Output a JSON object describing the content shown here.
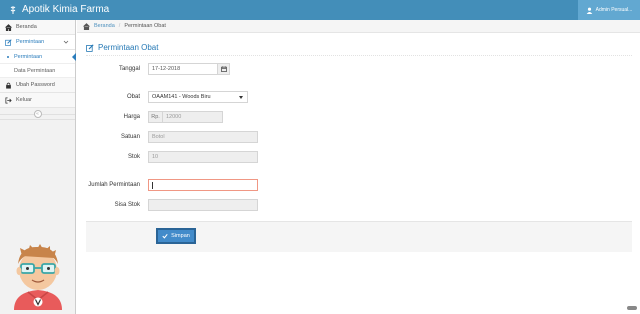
{
  "app": {
    "title": "Apotik Kimia Farma",
    "user": "Admin Persual..."
  },
  "sidebar": {
    "items": [
      {
        "label": "Beranda",
        "icon": "home-icon"
      },
      {
        "label": "Permintaan",
        "icon": "edit-icon"
      },
      {
        "label": "Ubah Password",
        "icon": "lock-icon"
      },
      {
        "label": "Keluar",
        "icon": "logout-icon"
      }
    ],
    "sub_items": [
      {
        "label": "Permintaan"
      },
      {
        "label": "Data Permintaan"
      }
    ],
    "collapse_glyph": "«"
  },
  "breadcrumb": {
    "home": "Beranda",
    "separator": "/",
    "current": "Permintaan Obat"
  },
  "page": {
    "title": "Permintaan Obat"
  },
  "form": {
    "tanggal": {
      "label": "Tanggal",
      "value": "17-12-2018"
    },
    "obat": {
      "label": "Obat",
      "value": "OAAM141 - Woods Biru"
    },
    "harga": {
      "label": "Harga",
      "prefix": "Rp.",
      "value": "12000"
    },
    "satuan": {
      "label": "Satuan",
      "value": "Botol"
    },
    "stok": {
      "label": "Stok",
      "value": "10"
    },
    "jumlah": {
      "label": "Jumlah Permintaan",
      "value": ""
    },
    "sisa": {
      "label": "Sisa Stok",
      "value": ""
    },
    "save_label": "Simpan"
  },
  "colors": {
    "primary": "#438eb9",
    "accent": "#2b7dbc",
    "button": "#428bca",
    "error_border": "#f09784"
  }
}
